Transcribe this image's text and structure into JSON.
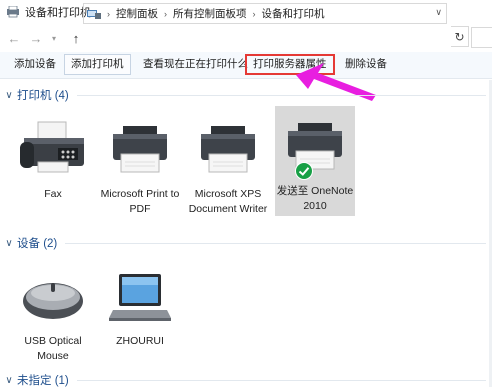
{
  "window": {
    "title": "设备和打印机"
  },
  "address": {
    "segments": [
      "控制面板",
      "所有控制面板项",
      "设备和打印机"
    ]
  },
  "toolbar": {
    "add_device": "添加设备",
    "add_printer": "添加打印机",
    "see_printing": "查看现在正在打印什么",
    "print_server_props": "打印服务器属性",
    "remove_device": "删除设备"
  },
  "printers": {
    "title": "打印机 (4)",
    "items": [
      {
        "label": "Fax",
        "icon": "fax-icon"
      },
      {
        "label": "Microsoft Print to PDF",
        "icon": "printer-icon"
      },
      {
        "label": "Microsoft XPS Document Writer",
        "icon": "printer-icon"
      },
      {
        "label": "发送至 OneNote 2010",
        "icon": "printer-icon",
        "default": true
      }
    ]
  },
  "devices": {
    "title": "设备 (2)",
    "items": [
      {
        "label": "USB Optical Mouse",
        "icon": "mouse-icon"
      },
      {
        "label": "ZHOURUI",
        "icon": "laptop-icon"
      }
    ]
  },
  "unspecified": {
    "title": "未指定 (1)"
  },
  "colors": {
    "accent": "#1e4e8c",
    "highlight_box": "#e53935",
    "arrow": "#e81ee0",
    "default_check": "#18a046"
  }
}
